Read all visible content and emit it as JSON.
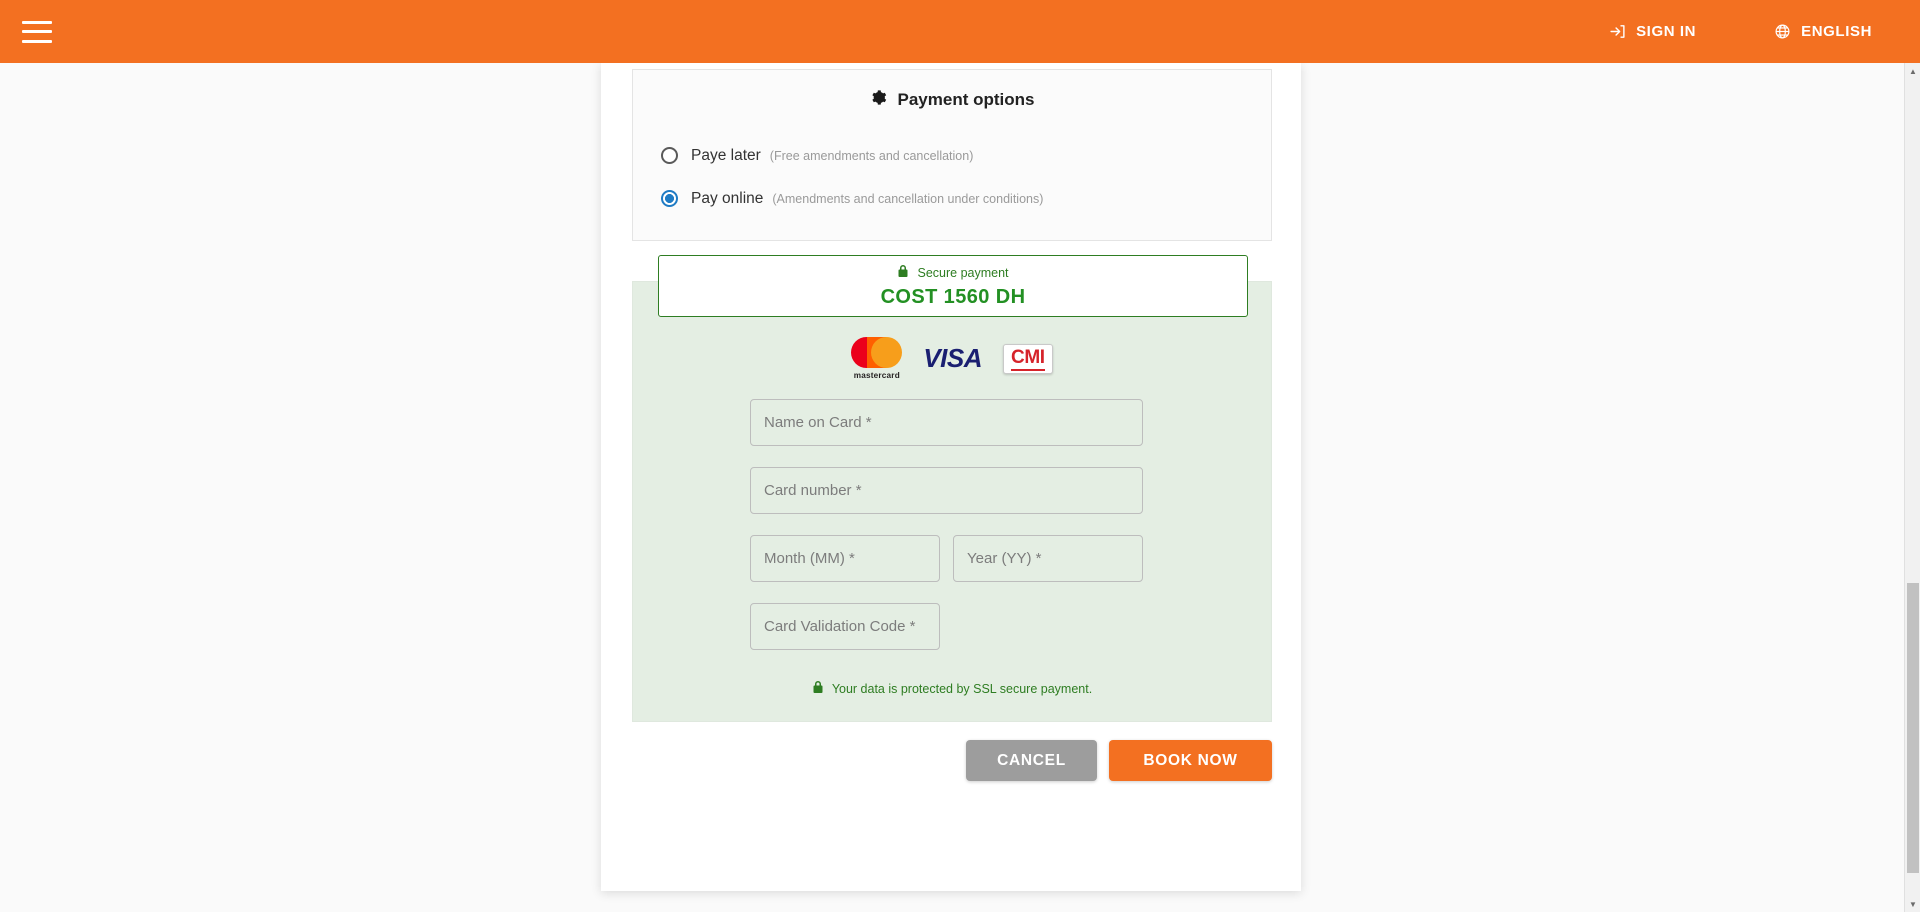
{
  "header": {
    "menu_icon": "hamburger-menu-icon",
    "sign_in": {
      "label": "SIGN IN",
      "icon": "sign-in-icon"
    },
    "language": {
      "label": "ENGLISH",
      "icon": "globe-icon"
    },
    "background_color": "#F37021"
  },
  "payment_options": {
    "title": "Payment options",
    "title_icon": "gear-icon",
    "choices": [
      {
        "label": "Paye later",
        "note": "(Free amendments and cancellation)",
        "selected": false
      },
      {
        "label": "Pay online",
        "note": "(Amendments and cancellation under conditions)",
        "selected": true
      }
    ],
    "selected_accent_color": "#1F7BC4"
  },
  "cost_box": {
    "secure_icon": "lock-icon",
    "secure_label": "Secure payment",
    "cost_label": "COST  1560 DH",
    "amount": 1560,
    "currency": "DH",
    "border_color": "#2E7D22",
    "text_color": "#239023"
  },
  "card_logos": [
    {
      "name": "mastercard-logo",
      "text": "mastercard"
    },
    {
      "name": "visa-logo",
      "text": "VISA"
    },
    {
      "name": "cmi-logo",
      "text": "CMI"
    }
  ],
  "payment_form": {
    "background_color": "#E4EEE3",
    "fields": {
      "name_on_card": {
        "placeholder": "Name on Card *",
        "value": ""
      },
      "card_number": {
        "placeholder": "Card number *",
        "value": ""
      },
      "month": {
        "placeholder": "Month (MM) *",
        "value": ""
      },
      "year": {
        "placeholder": "Year (YY) *",
        "value": ""
      },
      "cvc": {
        "placeholder": "Card Validation Code *",
        "value": ""
      }
    },
    "ssl_note": "Your data is protected by SSL secure payment.",
    "ssl_icon": "lock-icon"
  },
  "actions": {
    "cancel": {
      "label": "CANCEL",
      "color": "#9d9d9d"
    },
    "book_now": {
      "label": "BOOK NOW",
      "color": "#F37021"
    }
  }
}
